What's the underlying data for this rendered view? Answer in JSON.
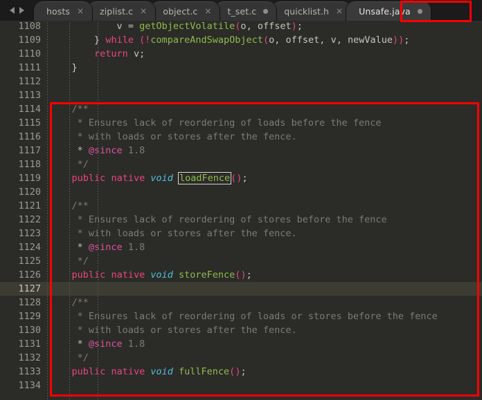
{
  "window": {
    "title": "Unsafe.java",
    "background_color": "#2b2b28",
    "highlight_color": "#ff0000"
  },
  "tabbar": {
    "nav_prev_label": "◀",
    "nav_next_label": "▶",
    "tabs": [
      {
        "label": "hosts",
        "indicator": "close",
        "indicator_label": "×",
        "active": false,
        "highlighted": false
      },
      {
        "label": "ziplist.c",
        "indicator": "close",
        "indicator_label": "×",
        "active": false,
        "highlighted": false
      },
      {
        "label": "object.c",
        "indicator": "close",
        "indicator_label": "×",
        "active": false,
        "highlighted": false
      },
      {
        "label": "t_set.c",
        "indicator": "dot",
        "indicator_label": "",
        "active": false,
        "highlighted": false
      },
      {
        "label": "quicklist.h",
        "indicator": "close",
        "indicator_label": "×",
        "active": false,
        "highlighted": false
      },
      {
        "label": "Unsafe.java",
        "indicator": "dot",
        "indicator_label": "",
        "active": true,
        "highlighted": true
      }
    ]
  },
  "editor": {
    "current_line": 1127,
    "first_line": 1108,
    "last_line": 1134,
    "line_numbers": [
      "1108",
      "1109",
      "1110",
      "1111",
      "1112",
      "1113",
      "1114",
      "1115",
      "1116",
      "1117",
      "1118",
      "1119",
      "1120",
      "1121",
      "1122",
      "1123",
      "1124",
      "1125",
      "1126",
      "1127",
      "1128",
      "1129",
      "1130",
      "1131",
      "1132",
      "1133",
      "1134"
    ],
    "lines": [
      "            v = getObjectVolatile(o, offset);",
      "        } while (!compareAndSwapObject(o, offset, v, newValue));",
      "        return v;",
      "    }",
      "",
      "",
      "    /**",
      "     * Ensures lack of reordering of loads before the fence",
      "     * with loads or stores after the fence.",
      "     * @since 1.8",
      "     */",
      "    public native void loadFence();",
      "",
      "    /**",
      "     * Ensures lack of reordering of stores before the fence",
      "     * with loads or stores after the fence.",
      "     * @since 1.8",
      "     */",
      "    public native void storeFence();",
      "",
      "    /**",
      "     * Ensures lack of reordering of loads or stores before the fence",
      "     * with loads or stores after the fence.",
      "     * @since 1.8",
      "     */",
      "    public native void fullFence();",
      ""
    ],
    "tokens": {
      "keyword_public": "public",
      "keyword_native": "native",
      "keyword_void": "void",
      "keyword_while": "while",
      "keyword_return": "return",
      "method_loadFence": "loadFence",
      "method_storeFence": "storeFence",
      "method_fullFence": "fullFence",
      "method_getObjectVolatile": "getObjectVolatile",
      "method_compareAndSwapObject": "compareAndSwapObject",
      "javadoc_tag_since": "@since",
      "javadoc_since_value": "1.8",
      "comment_open": "/**",
      "comment_close": "*/",
      "comment_line_loads": "* Ensures lack of reordering of loads before the fence",
      "comment_line_stores": "* Ensures lack of reordering of stores before the fence",
      "comment_line_loads_or_stores": "* Ensures lack of reordering of loads or stores before the fence",
      "comment_line_with": "* with loads or stores after the fence.",
      "var_v": "v",
      "var_o": "o",
      "var_offset": "offset",
      "var_newValue": "newValue"
    },
    "colors": {
      "keyword": "#e8477f",
      "type": "#4fc1d9",
      "comment": "#7d7d72",
      "javadoc_tag": "#e0559c",
      "method": "#8fbc4d",
      "plain": "#c8c6bd",
      "gutter_text": "#9b9b94",
      "current_line_bg": "#3c3c32"
    }
  }
}
